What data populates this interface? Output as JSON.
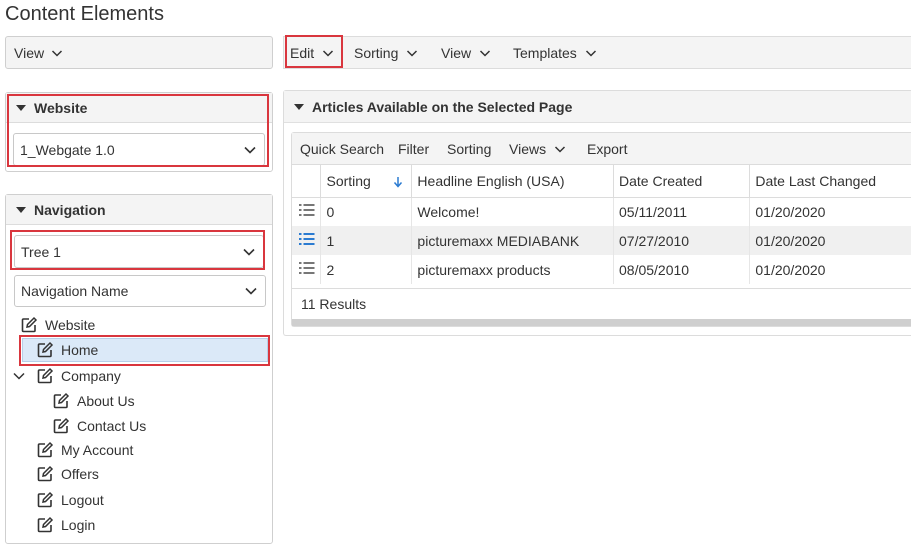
{
  "page": {
    "title": "Content Elements"
  },
  "left": {
    "view_label": "View",
    "website_panel": {
      "title": "Website",
      "selected": "1_Webgate 1.0"
    },
    "navigation_panel": {
      "title": "Navigation",
      "tree_select": "Tree 1",
      "name_select": "Navigation Name",
      "items": [
        {
          "label": "Website"
        },
        {
          "label": "Home"
        },
        {
          "label": "Company"
        },
        {
          "label": "About Us"
        },
        {
          "label": "Contact Us"
        },
        {
          "label": "My Account"
        },
        {
          "label": "Offers"
        },
        {
          "label": "Logout"
        },
        {
          "label": "Login"
        }
      ]
    }
  },
  "toolbar": {
    "edit": "Edit",
    "sorting": "Sorting",
    "view": "View",
    "templates": "Templates"
  },
  "articles": {
    "title": "Articles Available on the Selected Page",
    "grid_toolbar": {
      "quick_search": "Quick Search",
      "filter": "Filter",
      "sorting": "Sorting",
      "views": "Views",
      "export": "Export"
    },
    "columns": {
      "sorting": "Sorting",
      "headline": "Headline English (USA)",
      "created": "Date Created",
      "changed": "Date Last Changed"
    },
    "rows": [
      {
        "sorting": "0",
        "headline": "Welcome!",
        "created": "05/11/2011",
        "changed": "01/20/2020"
      },
      {
        "sorting": "1",
        "headline": "picturemaxx MEDIABANK",
        "created": "07/27/2010",
        "changed": "01/20/2020"
      },
      {
        "sorting": "2",
        "headline": "picturemaxx products",
        "created": "08/05/2010",
        "changed": "01/20/2020"
      }
    ],
    "results": "11 Results"
  },
  "colors": {
    "highlight_border": "#d9363e",
    "selected_bg": "#dbe9f8",
    "accent_blue": "#2b7bd1"
  },
  "icons": [
    "chevron-down-icon",
    "triangle-down-icon",
    "edit-icon",
    "list-icon",
    "sort-arrow-down-icon"
  ]
}
